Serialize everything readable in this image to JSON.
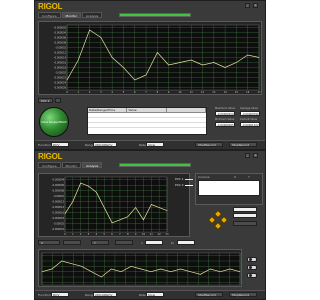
{
  "app": {
    "logo": "RIGOL",
    "minimize": "_",
    "close": "×"
  },
  "tabs": [
    {
      "label": "Configure"
    },
    {
      "label": "Monitor"
    },
    {
      "label": "Analysis"
    }
  ],
  "colors": {
    "trace_main": "#e6e6a0",
    "trace_alt": "#e6e6a0",
    "grid": "#4d8f4d",
    "progress": "#3ec43e",
    "brand": "#e8b800"
  },
  "top_panel": {
    "progress_percent": 100,
    "y_ticks": [
      "-0.000002",
      "-0.000004",
      "-0.000006",
      "-0.000008",
      "-0.00001",
      "-0.000012",
      "-0.000014",
      "-0.000016",
      "-0.000018",
      "-0.00002",
      "-0.000022",
      "-0.000024",
      "-0.000026"
    ],
    "x_ticks": [
      "0",
      "1",
      "2",
      "3",
      "4",
      "5",
      "6",
      "7",
      "8",
      "9",
      "10",
      "11",
      "12",
      "13",
      "14",
      "15",
      "16",
      "17"
    ],
    "chart_data": {
      "type": "line",
      "x": [
        0,
        1,
        2,
        3,
        4,
        5,
        6,
        7,
        8,
        9,
        10,
        11,
        12,
        13,
        14,
        15,
        16,
        17
      ],
      "y": [
        -2.2e-05,
        -1.4e-05,
        -2e-06,
        -5e-06,
        -1.3e-05,
        -1.7e-05,
        -2.2e-05,
        -2e-05,
        -1.1e-05,
        -1.6e-05,
        -1.5e-05,
        -1.4e-05,
        -1.6e-05,
        -1.5e-05,
        -1.7e-05,
        -1.5e-05,
        -1.2e-05,
        -1.3e-05
      ],
      "ylim": [
        -2.6e-05,
        0
      ],
      "xlim": [
        0,
        17
      ],
      "grid": true
    },
    "plot_label": "Plot 1",
    "orb_label": "Show Rangle/dBmW",
    "table_headers": [
      "Date/Range/Time",
      "Value",
      ""
    ],
    "stats": {
      "max_label": "Maximum Value",
      "max_value": "-0.00000250",
      "avg_label": "Average Value",
      "avg_value": "-0.00000792",
      "min_label": "Minimum Value",
      "min_value": "-0.00000285",
      "cur_label": "Current Value",
      "cur_value": "-0.00001322"
    },
    "footer": {
      "function_label": "Function",
      "function_value": "DCV",
      "range_label": "Range",
      "range_value": "200.000mV",
      "rate_label": "Rate",
      "rate_value": "Slow",
      "btn1": "StartRecord",
      "btn2": "StopRecord"
    }
  },
  "bottom_panel": {
    "progress_percent": 100,
    "y_ticks": [
      "-0.000004",
      "-0.000006",
      "-0.000008",
      "-0.00001",
      "-0.000012",
      "-0.000014",
      "-0.000016",
      "-0.000018",
      "-0.00002",
      "-0.000022"
    ],
    "x_ticks": [
      "0",
      "1",
      "2",
      "3",
      "4",
      "5",
      "6",
      "7",
      "8",
      "9",
      "10",
      "11",
      "12",
      "13"
    ],
    "legend": [
      {
        "name": "Plot 1"
      },
      {
        "name": "Plot 2"
      }
    ],
    "chart_data": {
      "type": "line",
      "x": [
        0,
        1,
        2,
        3,
        4,
        5,
        6,
        7,
        8,
        9,
        10,
        11,
        12,
        13
      ],
      "y": [
        -1.6e-05,
        -1.2e-05,
        -6e-06,
        -7e-06,
        -9e-06,
        -1.4e-05,
        -1.9e-05,
        -1.8e-05,
        -1.7e-05,
        -1.4e-05,
        -1.8e-05,
        -1.3e-05,
        -1.4e-05,
        -1.5e-05
      ],
      "ylim": [
        -2.2e-05,
        -4e-06
      ],
      "xlim": [
        0,
        13
      ],
      "grid": true
    },
    "cursors_label": "Cursors",
    "cursor_cols": [
      "X",
      "Y"
    ],
    "mini_chart_data": {
      "type": "line",
      "x": [
        0,
        1,
        2,
        3,
        4,
        5,
        6,
        7,
        8,
        9,
        10,
        11,
        12,
        13,
        14,
        15,
        16,
        17,
        18,
        19,
        20
      ],
      "y": [
        5,
        6,
        9,
        8,
        7,
        5,
        3,
        6,
        5,
        7,
        6,
        5,
        6,
        5,
        6,
        5,
        4,
        6,
        5,
        6,
        5
      ],
      "ylim": [
        0,
        12
      ],
      "grid": true
    },
    "x_axis_ctrl": "X",
    "y_axis_ctrl": "Y",
    "from_label": "x",
    "to_label": "to",
    "footer": {
      "function_label": "Function",
      "function_value": "DCV",
      "range_label": "Range",
      "range_value": "200.000mV",
      "rate_label": "Rate",
      "rate_value": "Slow",
      "btn1": "StartRecord",
      "btn2": "StopRecord"
    }
  }
}
